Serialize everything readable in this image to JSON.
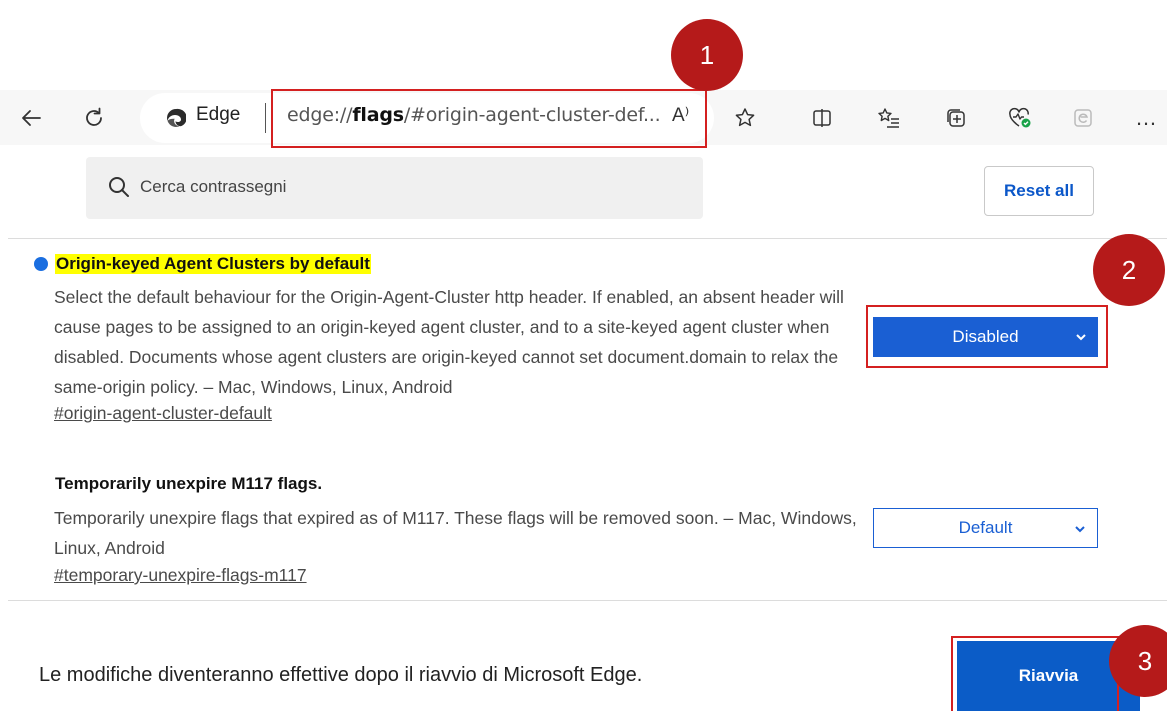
{
  "toolbar": {
    "site_label": "Edge",
    "url_prefix": "edge://",
    "url_bold": "flags",
    "url_rest": "/#origin-agent-cluster-def...",
    "read_aloud": "A⁾",
    "more": "…"
  },
  "search": {
    "placeholder": "Cerca contrassegni",
    "reset_label": "Reset all"
  },
  "flags": [
    {
      "title": "Origin-keyed Agent Clusters by default",
      "description": "Select the default behaviour for the Origin-Agent-Cluster http header. If enabled, an absent header will cause pages to be assigned to an origin-keyed agent cluster, and to a site-keyed agent cluster when disabled. Documents whose agent clusters are origin-keyed cannot set document.domain to relax the same-origin policy. – Mac, Windows, Linux, Android",
      "link": "#origin-agent-cluster-default",
      "value": "Disabled"
    },
    {
      "title": "Temporarily unexpire M117 flags.",
      "description": "Temporarily unexpire flags that expired as of M117. These flags will be removed soon. – Mac, Windows, Linux, Android",
      "link": "#temporary-unexpire-flags-m117",
      "value": "Default"
    }
  ],
  "footer": {
    "message": "Le modifiche diventeranno effettive dopo il riavvio di Microsoft Edge.",
    "restart_label": "Riavvia"
  },
  "annotations": [
    "1",
    "2",
    "3"
  ],
  "colors": {
    "accent": "#1a5fd3",
    "annotation": "#b51a1a",
    "highlight": "#ffff00"
  }
}
